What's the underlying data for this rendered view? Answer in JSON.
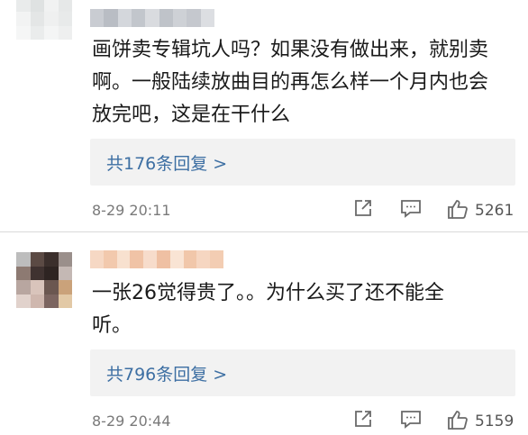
{
  "comments": [
    {
      "text": "画饼卖专辑坑人吗？如果没有做出来，就别卖\n啊。一般陆续放曲目的再怎么样一个月内也会\n放完吧，这是在干什么",
      "reply_link": "共176条回复 >",
      "timestamp": "8-29 20:11",
      "like_count": "5261"
    },
    {
      "text": "一张26觉得贵了。。为什么买了还不能全\n听。",
      "reply_link": "共796条回复 >",
      "timestamp": "8-29 20:44",
      "like_count": "5159"
    }
  ],
  "icons": {
    "share": "share-icon",
    "comment": "comment-icon",
    "like": "thumbs-up-icon"
  },
  "colors": {
    "link": "#3d6fa3",
    "reply_box_bg": "#f2f2f2",
    "meta_text": "#7a7a7a"
  }
}
